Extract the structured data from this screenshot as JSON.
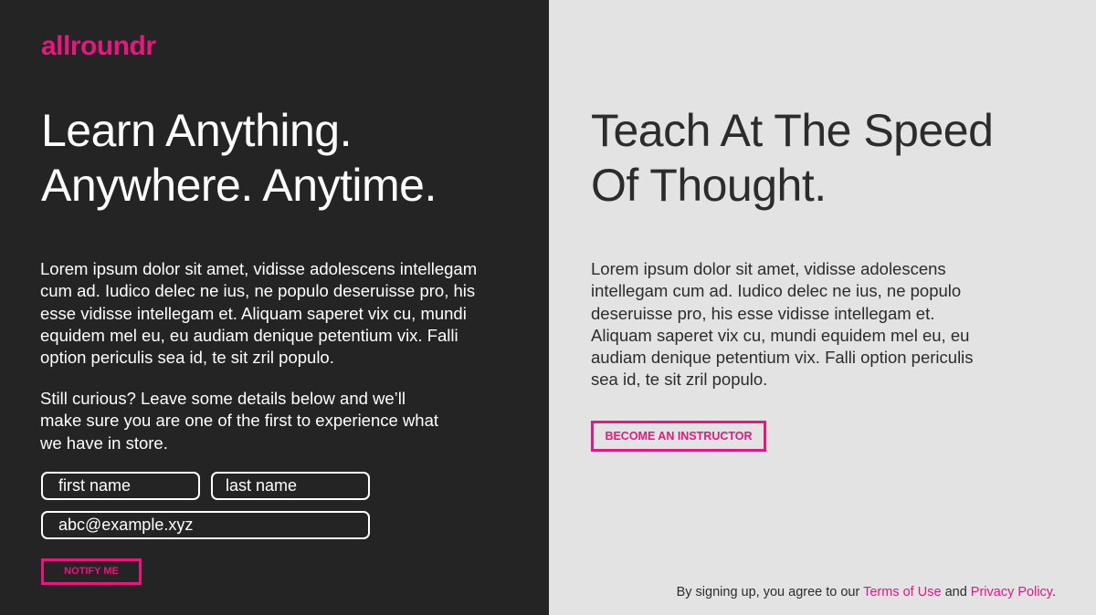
{
  "brand": {
    "logo": "allroundr",
    "accent_color": "#e8167f"
  },
  "learn": {
    "headline_1": "Learn Anything.",
    "headline_2": "Anywhere. Anytime.",
    "body_1": "Lorem ipsum dolor sit amet, vidisse adolescens intellegam",
    "body_2": "cum ad. Iudico delec ne ius, ne populo deseruisse pro, his",
    "body_3": "esse vidisse intellegam et. Aliquam saperet vix cu, mundi",
    "body_4": "equidem mel eu, eu audiam denique petentium vix. Falli",
    "body_5": "option periculis sea id, te sit zril populo.",
    "cta_1": "Still curious? Leave some details below and we’ll",
    "cta_2": "make sure you are one of the first to experience what",
    "cta_3": "we have in store.",
    "form": {
      "first_name_placeholder": "first name",
      "last_name_placeholder": "last name",
      "email_placeholder": "abc@example.xyz",
      "notify_label": "NOTIFY ME"
    }
  },
  "teach": {
    "headline_1": "Teach At The Speed",
    "headline_2": "Of Thought.",
    "body_1": "Lorem ipsum dolor sit amet, vidisse adolescens",
    "body_2": "intellegam cum ad. Iudico delec ne ius, ne populo",
    "body_3": "deseruisse pro, his esse vidisse intellegam et.",
    "body_4": "Aliquam saperet vix cu, mundi equidem mel eu, eu",
    "body_5": "audiam denique petentium vix. Falli option periculis",
    "body_6": "sea id, te sit zril populo.",
    "button_label": "BECOME AN INSTRUCTOR"
  },
  "legal": {
    "prefix": "By signing up, you agree to our",
    "terms": "Terms of Use",
    "conj": "and",
    "privacy": "Privacy Policy",
    "suffix": "."
  }
}
